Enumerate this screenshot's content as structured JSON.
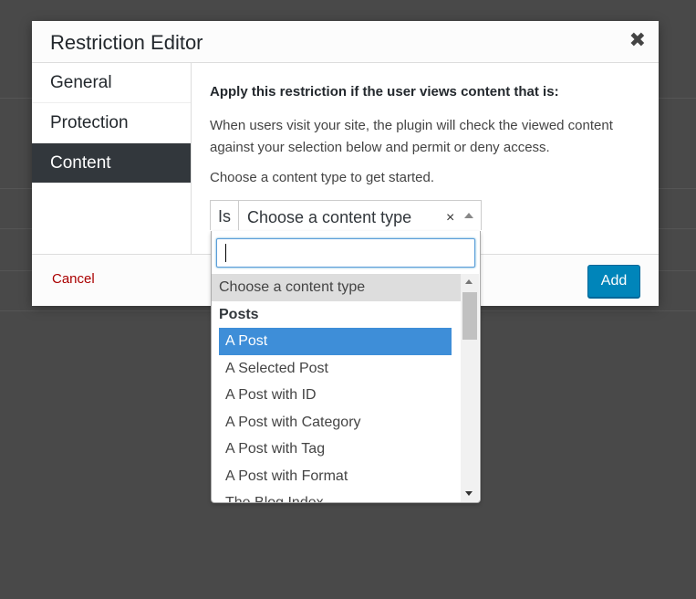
{
  "dialog": {
    "title": "Restriction Editor",
    "close_glyph": "✖"
  },
  "tabs": [
    {
      "label": "General",
      "active": false
    },
    {
      "label": "Protection",
      "active": false
    },
    {
      "label": "Content",
      "active": true
    }
  ],
  "content": {
    "heading": "Apply this restriction if the user views content that is:",
    "description": "When users visit your site, the plugin will check the viewed content against your selection below and permit or deny access.",
    "prompt": "Choose a content type to get started.",
    "condition_label": "Is",
    "select_value": "Choose a content type",
    "clear_glyph": "×"
  },
  "dropdown": {
    "search_value": "",
    "options": [
      {
        "label": "Choose a content type",
        "kind": "placeholder"
      },
      {
        "label": "Posts",
        "kind": "group"
      },
      {
        "label": "A Post",
        "kind": "highlight"
      },
      {
        "label": "A Selected Post",
        "kind": "option"
      },
      {
        "label": "A Post with ID",
        "kind": "option"
      },
      {
        "label": "A Post with Category",
        "kind": "option"
      },
      {
        "label": "A Post with Tag",
        "kind": "option"
      },
      {
        "label": "A Post with Format",
        "kind": "option"
      },
      {
        "label": "The Blog Index",
        "kind": "option"
      }
    ]
  },
  "footer": {
    "cancel_label": "Cancel",
    "add_label": "Add"
  },
  "colors": {
    "accent": "#0085ba",
    "highlight": "#3e8ed8",
    "active_tab": "#32373c",
    "cancel": "#aa0000",
    "overlay": "#494949"
  }
}
